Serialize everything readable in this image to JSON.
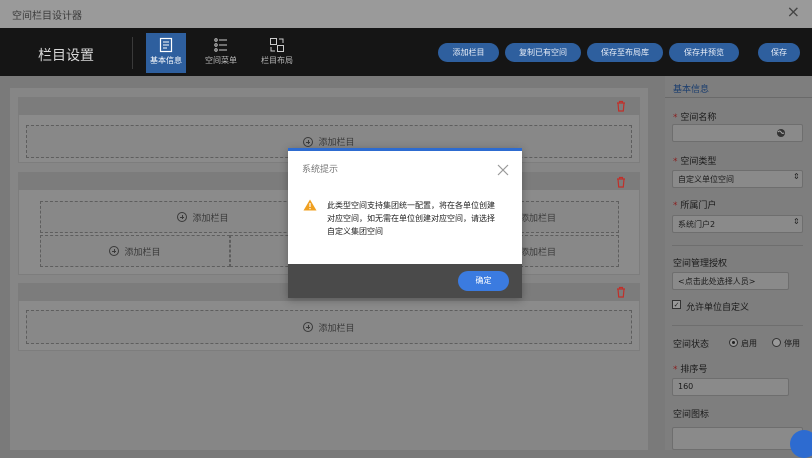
{
  "window": {
    "title": "空间栏目设计器",
    "close": "×"
  },
  "toolbar": {
    "title": "栏目设置",
    "tabs": [
      {
        "label": "基本信息",
        "icon": "document-icon"
      },
      {
        "label": "空间菜单",
        "icon": "menu-list-icon"
      },
      {
        "label": "栏目布局",
        "icon": "layout-icon"
      }
    ],
    "buttons": [
      "添加栏目",
      "复制已有空间",
      "保存至布局库",
      "保存并预览",
      "保存"
    ]
  },
  "canvas": {
    "add_column": "添加栏目"
  },
  "right_panel": {
    "header": "基本信息",
    "space_name_label": "空间名称",
    "space_type_label": "空间类型",
    "space_type_value": "自定义单位空间",
    "portal_label": "所属门户",
    "portal_value": "系统门户2",
    "auth_label": "空间管理授权",
    "auth_placeholder": "<点击此处选择人员>",
    "allow_custom_label": "允许单位自定义",
    "status_label": "空间状态",
    "status_enabled": "启用",
    "status_disabled": "停用",
    "order_label": "排序号",
    "order_value": "160",
    "icon_label": "空间图标"
  },
  "modal": {
    "title": "系统提示",
    "message": "此类型空间支持集团统一配置，将在各单位创建对应空间，如无需在单位创建对应空间，请选择自定义集团空间",
    "ok": "确定"
  },
  "colors": {
    "accent": "#2e5f9e",
    "modal_border": "#2d6bd0",
    "ok_button": "#3b7be0"
  }
}
